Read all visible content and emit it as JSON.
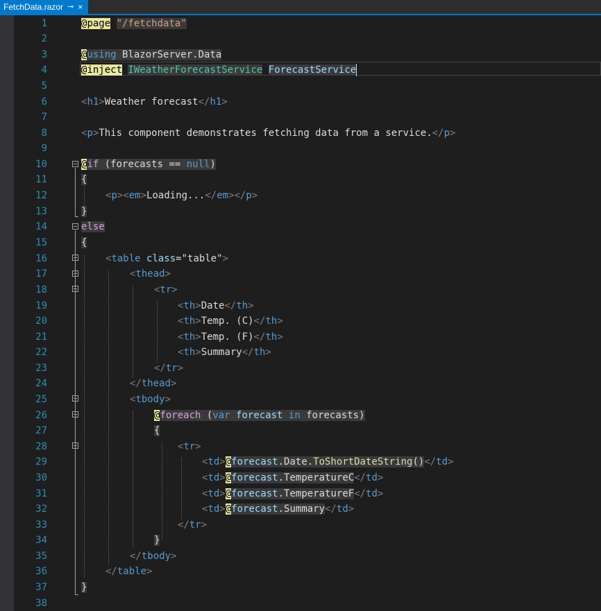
{
  "tab": {
    "filename": "FetchData.razor",
    "pin_glyph": "⊸",
    "close_glyph": "×"
  },
  "lines": [
    "1",
    "2",
    "3",
    "4",
    "5",
    "6",
    "7",
    "8",
    "9",
    "10",
    "11",
    "12",
    "13",
    "14",
    "15",
    "16",
    "17",
    "18",
    "19",
    "20",
    "21",
    "22",
    "23",
    "24",
    "25",
    "26",
    "27",
    "28",
    "29",
    "30",
    "31",
    "32",
    "33",
    "34",
    "35",
    "36",
    "37",
    "38"
  ],
  "code": {
    "l1": {
      "at": "@",
      "kw": "page",
      "str": "\"/fetchdata\""
    },
    "l3": {
      "at": "@",
      "kw": "using",
      "ns": " BlazorServer.Data"
    },
    "l4": {
      "at": "@",
      "kw": "inject",
      "type": "IWeatherForecastService",
      "name": "ForecastService"
    },
    "l6": {
      "open": "<",
      "tag": "h1",
      "close": ">",
      "text": "Weather forecast",
      "etag_open": "</",
      "etag": "h1",
      "etag_close": ">"
    },
    "l8": {
      "open": "<",
      "tag": "p",
      "close": ">",
      "text": "This component demonstrates fetching data from a service.",
      "etag_open": "</",
      "etag": "p",
      "etag_close": ">"
    },
    "l10": {
      "at": "@",
      "kw": "if",
      "rest1": " (forecasts ",
      "op": "==",
      "sp": " ",
      "nullkw": "null",
      "rest2": ")"
    },
    "l11": "{",
    "l12": {
      "p_open": "<",
      "p": "p",
      "gt": ">",
      "em_open": "<",
      "em": "em",
      "gt2": ">",
      "text": "Loading...",
      "em_c_open": "</",
      "em_c": "em",
      "gt3": ">",
      "p_c_open": "</",
      "p_c": "p",
      "gt4": ">"
    },
    "l13": "}",
    "l14": "else",
    "l15": "{",
    "l16": {
      "lt": "<",
      "tag": "table",
      "attr": " class",
      "eq": "=",
      "val": "\"table\"",
      "gt": ">"
    },
    "l17": {
      "lt": "<",
      "tag": "thead",
      "gt": ">"
    },
    "l18": {
      "lt": "<",
      "tag": "tr",
      "gt": ">"
    },
    "l19": {
      "text": "Date"
    },
    "l20": {
      "text": "Temp. (C)"
    },
    "l21": {
      "text": "Temp. (F)"
    },
    "l22": {
      "text": "Summary"
    },
    "l23": {
      "lt": "</",
      "tag": "tr",
      "gt": ">"
    },
    "l24": {
      "lt": "</",
      "tag": "thead",
      "gt": ">"
    },
    "l25": {
      "lt": "<",
      "tag": "tbody",
      "gt": ">"
    },
    "l26": {
      "at": "@",
      "kw": "foreach",
      "p1": " (",
      "var": "var",
      "sp": " ",
      "ident": "forecast",
      "sp2": " ",
      "in": "in",
      "sp3": " ",
      "coll": "forecasts",
      "p2": ")"
    },
    "l27": "{",
    "l28": {
      "lt": "<",
      "tag": "tr",
      "gt": ">"
    },
    "l29": {
      "obj": "forecast",
      "member": ".Date.",
      "method": "ToShortDateString",
      "call": "()"
    },
    "l30": {
      "obj": "forecast",
      "member": ".TemperatureC"
    },
    "l31": {
      "obj": "forecast",
      "member": ".TemperatureF"
    },
    "l32": {
      "obj": "forecast",
      "member": ".Summary"
    },
    "l33": {
      "lt": "</",
      "tag": "tr",
      "gt": ">"
    },
    "l34": "}",
    "l35": {
      "lt": "</",
      "tag": "tbody",
      "gt": ">"
    },
    "l36": {
      "lt": "</",
      "tag": "table",
      "gt": ">"
    },
    "l37": "}",
    "th": {
      "lt": "<",
      "tag": "th",
      "gt": ">",
      "clt": "</",
      "ctag": "th",
      "cgt": ">"
    },
    "td": {
      "lt": "<",
      "tag": "td",
      "gt": ">",
      "at": "@",
      "clt": "</",
      "ctag": "td",
      "cgt": ">"
    }
  },
  "colors": {
    "background": "#1e1e1e",
    "line_number": "#2b91af",
    "tab_active": "#007acc",
    "razor_highlight": "#e8e8a0",
    "html_tag": "#569cd6",
    "control_keyword": "#d8a0df",
    "string": "#d69d85",
    "type": "#4ec9b0"
  },
  "icons": [
    "pin-icon",
    "close-icon",
    "fold-collapse-icon"
  ]
}
